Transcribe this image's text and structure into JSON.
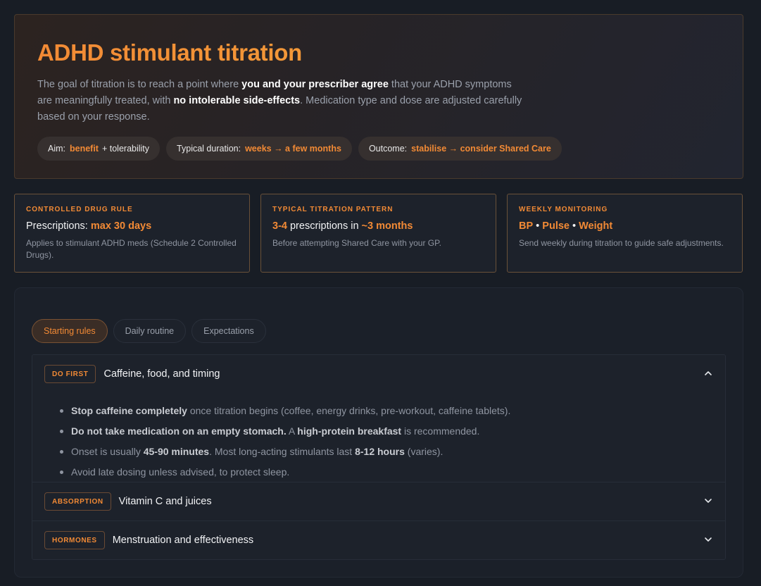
{
  "hero": {
    "title": "ADHD stimulant titration",
    "desc_1": "The goal of titration is to reach a point where ",
    "desc_b1": "you and your prescriber agree",
    "desc_2": " that your ADHD symptoms are meaningfully treated, with ",
    "desc_b2": "no intolerable side-effects",
    "desc_3": ". Medication type and dose are adjusted carefully based on your response.",
    "pills": [
      {
        "label": "Aim:",
        "value": "benefit",
        "tail": "+ tolerability"
      },
      {
        "label": "Typical duration:",
        "value": "weeks → a few months"
      },
      {
        "label": "Outcome:",
        "value": "stabilise → consider Shared Care"
      }
    ]
  },
  "cards": [
    {
      "kicker": "CONTROLLED DRUG RULE",
      "head_pre": "Prescriptions: ",
      "head_acc": "max 30 days",
      "note": "Applies to stimulant ADHD meds (Schedule 2 Controlled Drugs)."
    },
    {
      "kicker": "TYPICAL TITRATION PATTERN",
      "acc_1": "3-4",
      "mid": " prescriptions in ",
      "acc_2": "~3 months",
      "note": "Before attempting Shared Care with your GP."
    },
    {
      "kicker": "WEEKLY MONITORING",
      "acc_1": "BP",
      "acc_2": "Pulse",
      "acc_3": "Weight",
      "sep": " • ",
      "note": "Send weekly during titration to guide safe adjustments."
    }
  ],
  "tabs": [
    "Starting rules",
    "Daily routine",
    "Expectations"
  ],
  "accordion": {
    "items": [
      {
        "tag": "DO FIRST",
        "title": "Caffeine, food, and timing",
        "expanded": true
      },
      {
        "tag": "ABSORPTION",
        "title": "Vitamin C and juices",
        "expanded": false
      },
      {
        "tag": "HORMONES",
        "title": "Menstruation and effectiveness",
        "expanded": false
      }
    ],
    "bullets": {
      "b1_bold": "Stop caffeine completely",
      "b1_rest": " once titration begins (coffee, energy drinks, pre-workout, caffeine tablets).",
      "b2_bold": "Do not take medication on an empty stomach.",
      "b2_mid": " A ",
      "b2_bold2": "high-protein breakfast",
      "b2_rest": " is recommended.",
      "b3_pre": "Onset is usually ",
      "b3_bold": "45-90 minutes",
      "b3_mid": ". Most long-acting stimulants last ",
      "b3_bold2": "8-12 hours",
      "b3_rest": " (varies).",
      "b4": "Avoid late dosing unless advised, to protect sleep."
    }
  },
  "colors": {
    "accent": "#f28a35",
    "background": "#181d25"
  },
  "icons": {
    "expanded": "chevron-up-icon",
    "collapsed": "chevron-down-icon"
  }
}
